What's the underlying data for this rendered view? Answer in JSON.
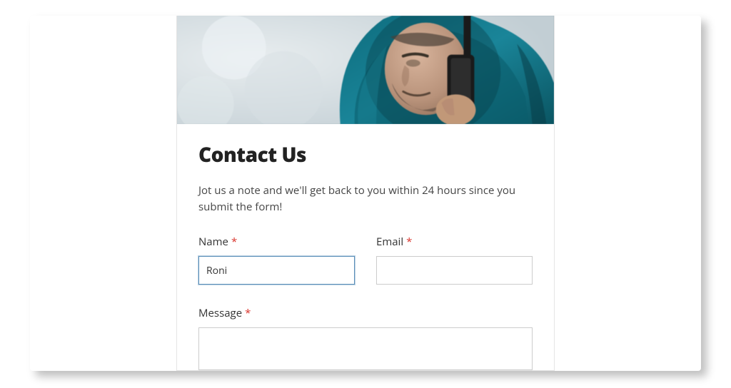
{
  "form": {
    "heading": "Contact Us",
    "description": "Jot us a note and we'll get back to you within 24 hours since you submit the form!",
    "fields": {
      "name": {
        "label": "Name",
        "required_mark": "*",
        "value": "Roni"
      },
      "email": {
        "label": "Email",
        "required_mark": "*",
        "value": ""
      },
      "message": {
        "label": "Message",
        "required_mark": "*",
        "value": ""
      }
    }
  }
}
